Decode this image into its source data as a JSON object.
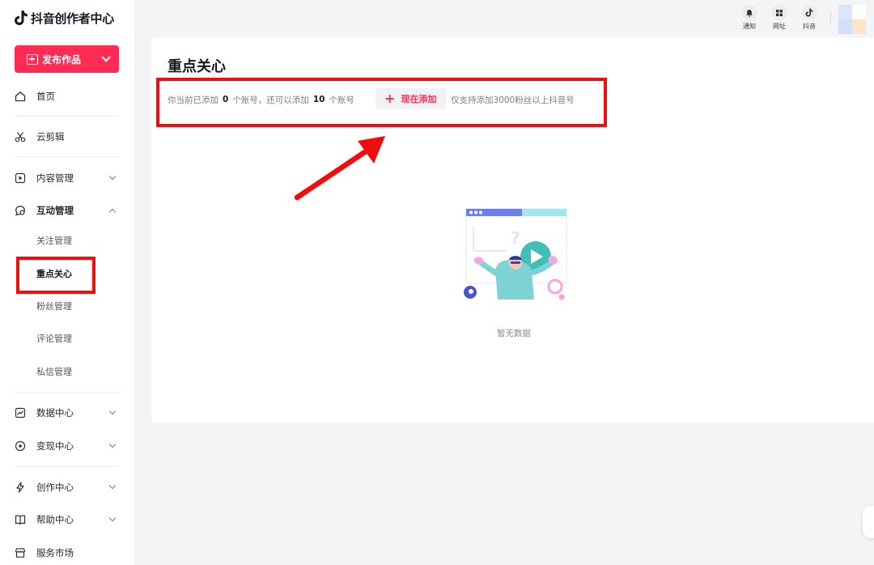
{
  "app": {
    "title": "抖音创作者中心"
  },
  "sidebar": {
    "publish_label": "发布作品",
    "items": [
      {
        "label": "首页",
        "icon": "home-icon"
      },
      {
        "label": "云剪辑",
        "icon": "scissors-icon"
      },
      {
        "label": "内容管理",
        "icon": "play-square-icon"
      },
      {
        "label": "互动管理",
        "icon": "chat-bubble-icon"
      },
      {
        "label": "数据中心",
        "icon": "chart-line-icon"
      },
      {
        "label": "变现中心",
        "icon": "coin-icon"
      },
      {
        "label": "创作中心",
        "icon": "lightning-icon"
      },
      {
        "label": "帮助中心",
        "icon": "book-icon"
      },
      {
        "label": "服务市场",
        "icon": "store-icon"
      }
    ],
    "sub_items": [
      {
        "label": "关注管理"
      },
      {
        "label": "重点关心",
        "active": true
      },
      {
        "label": "粉丝管理"
      },
      {
        "label": "评论管理"
      },
      {
        "label": "私信管理"
      }
    ]
  },
  "topbar": {
    "items": [
      {
        "label": "通知",
        "icon": "bell-icon"
      },
      {
        "label": "网址",
        "icon": "grid-icon"
      },
      {
        "label": "抖音",
        "icon": "douyin-icon"
      }
    ]
  },
  "main": {
    "title": "重点关心",
    "info_prefix": "你当前已添加",
    "added_count": "0",
    "info_mid": "个账号，还可以添加",
    "remaining_count": "10",
    "info_suffix": "个账号",
    "add_button_label": "现在添加",
    "note": "仅支持添加3000粉丝以上抖音号",
    "empty_text": "暂无数据"
  },
  "colors": {
    "brand": "#fe2c55",
    "annotation_red": "#f20d0d"
  }
}
